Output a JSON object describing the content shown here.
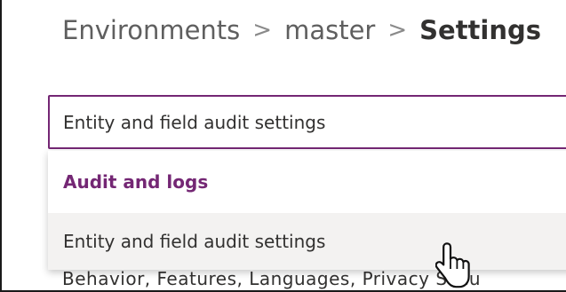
{
  "breadcrumb": {
    "items": [
      "Environments",
      "master",
      "Settings"
    ],
    "separator": ">"
  },
  "search": {
    "value": "Entity and field audit settings"
  },
  "dropdown": {
    "group_header": "Audit and logs",
    "option": "Entity and field audit settings"
  },
  "background": {
    "partial_text": "Behavior, Features, Languages, Privacy   Secu"
  },
  "colors": {
    "accent": "#742774",
    "text": "#323130",
    "muted": "#5f5f5f",
    "hover": "#f3f2f1"
  },
  "icons": {
    "cursor": "hand-pointer-icon"
  }
}
